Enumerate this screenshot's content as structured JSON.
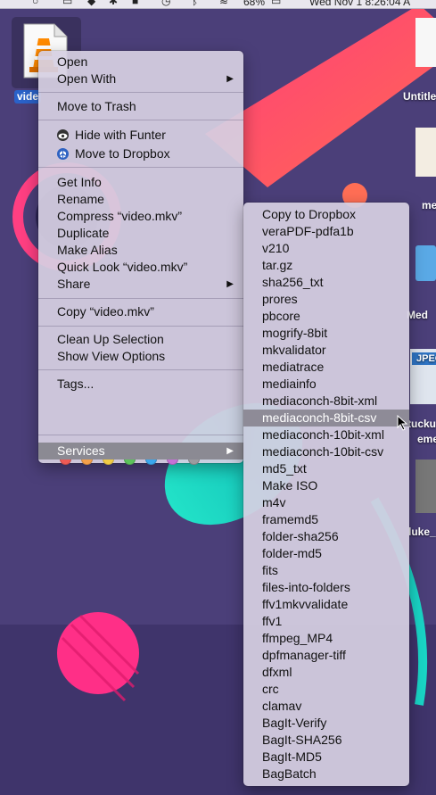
{
  "menubar": {
    "battery": "68%",
    "clock": "Wed Nov 1  8:26:04 A"
  },
  "file_icon": {
    "label": "vide"
  },
  "desktop_items": [
    {
      "name": "desktop-item-untitled",
      "label": "Untitle"
    },
    {
      "name": "desktop-item-me",
      "label": "me"
    },
    {
      "name": "desktop-item-med",
      "label": "Med"
    },
    {
      "name": "desktop-item-jpeg",
      "label": "JPEG"
    },
    {
      "name": "desktop-item-tucku",
      "label": "tucku"
    },
    {
      "name": "desktop-item-eme",
      "label": "eme"
    },
    {
      "name": "desktop-item-luke",
      "label": "luke_"
    }
  ],
  "context_menu": {
    "open": "Open",
    "open_with": "Open With",
    "move_to_trash": "Move to Trash",
    "hide_with_funter": "Hide with Funter",
    "move_to_dropbox": "Move to Dropbox",
    "get_info": "Get Info",
    "rename": "Rename",
    "compress": "Compress “video.mkv”",
    "duplicate": "Duplicate",
    "make_alias": "Make Alias",
    "quick_look": "Quick Look “video.mkv”",
    "share": "Share",
    "copy": "Copy “video.mkv”",
    "clean_up_selection": "Clean Up Selection",
    "show_view_options": "Show View Options",
    "tags": "Tags...",
    "services": "Services",
    "tag_colors": [
      "#ee5a55",
      "#f5a04a",
      "#f2cc46",
      "#5cc35b",
      "#3aa7ee",
      "#c572d6",
      "#9b9b9f"
    ]
  },
  "services_menu": {
    "items": [
      "Copy to Dropbox",
      "veraPDF-pdfa1b",
      "v210",
      "tar.gz",
      "sha256_txt",
      "prores",
      "pbcore",
      "mogrify-8bit",
      "mkvalidator",
      "mediatrace",
      "mediainfo",
      "mediaconch-8bit-xml",
      "mediaconch-8bit-csv",
      "mediaconch-10bit-xml",
      "mediaconch-10bit-csv",
      "md5_txt",
      "Make ISO",
      "m4v",
      "framemd5",
      "folder-sha256",
      "folder-md5",
      "fits",
      "files-into-folders",
      "ffv1mkvvalidate",
      "ffv1",
      "ffmpeg_MP4",
      "dpfmanager-tiff",
      "dfxml",
      "crc",
      "clamav",
      "BagIt-Verify",
      "BagIt-SHA256",
      "BagIt-MD5",
      "BagBatch"
    ],
    "highlighted": "mediaconch-8bit-csv"
  }
}
